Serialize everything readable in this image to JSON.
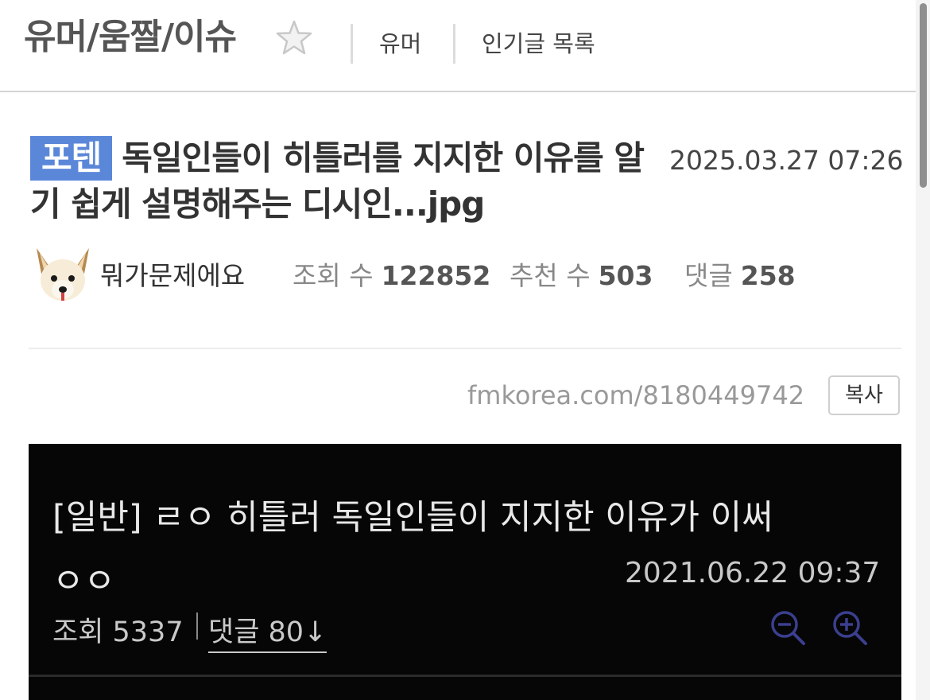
{
  "header": {
    "board_title": "유머/움짤/이슈",
    "nav": [
      "유머",
      "인기글 목록"
    ]
  },
  "post": {
    "badge": "포텐",
    "title": "독일인들이 히틀러를 지지한 이유를 알기 쉽게 설명해주는 디시인...jpg",
    "date": "2025.03.27 07:26",
    "author": "뭐가문제에요",
    "stats": {
      "views_label": "조회 수",
      "views": "122852",
      "likes_label": "추천 수",
      "likes": "503",
      "comments_label": "댓글",
      "comments": "258"
    },
    "url": "fmkorea.com/8180449742",
    "copy_label": "복사"
  },
  "embedded": {
    "title": "[일반] ㄹㅇ 히틀러 독일인들이 지지한 이유가 이써",
    "title_cont": "ㅇㅇ",
    "date": "2021.06.22 09:37",
    "views": "조회 5337",
    "comments": "댓글 80↓"
  },
  "colors": {
    "badge_bg": "#5b87d9",
    "embed_bg": "#060606",
    "zoom_icon": "#3b3f8f"
  }
}
